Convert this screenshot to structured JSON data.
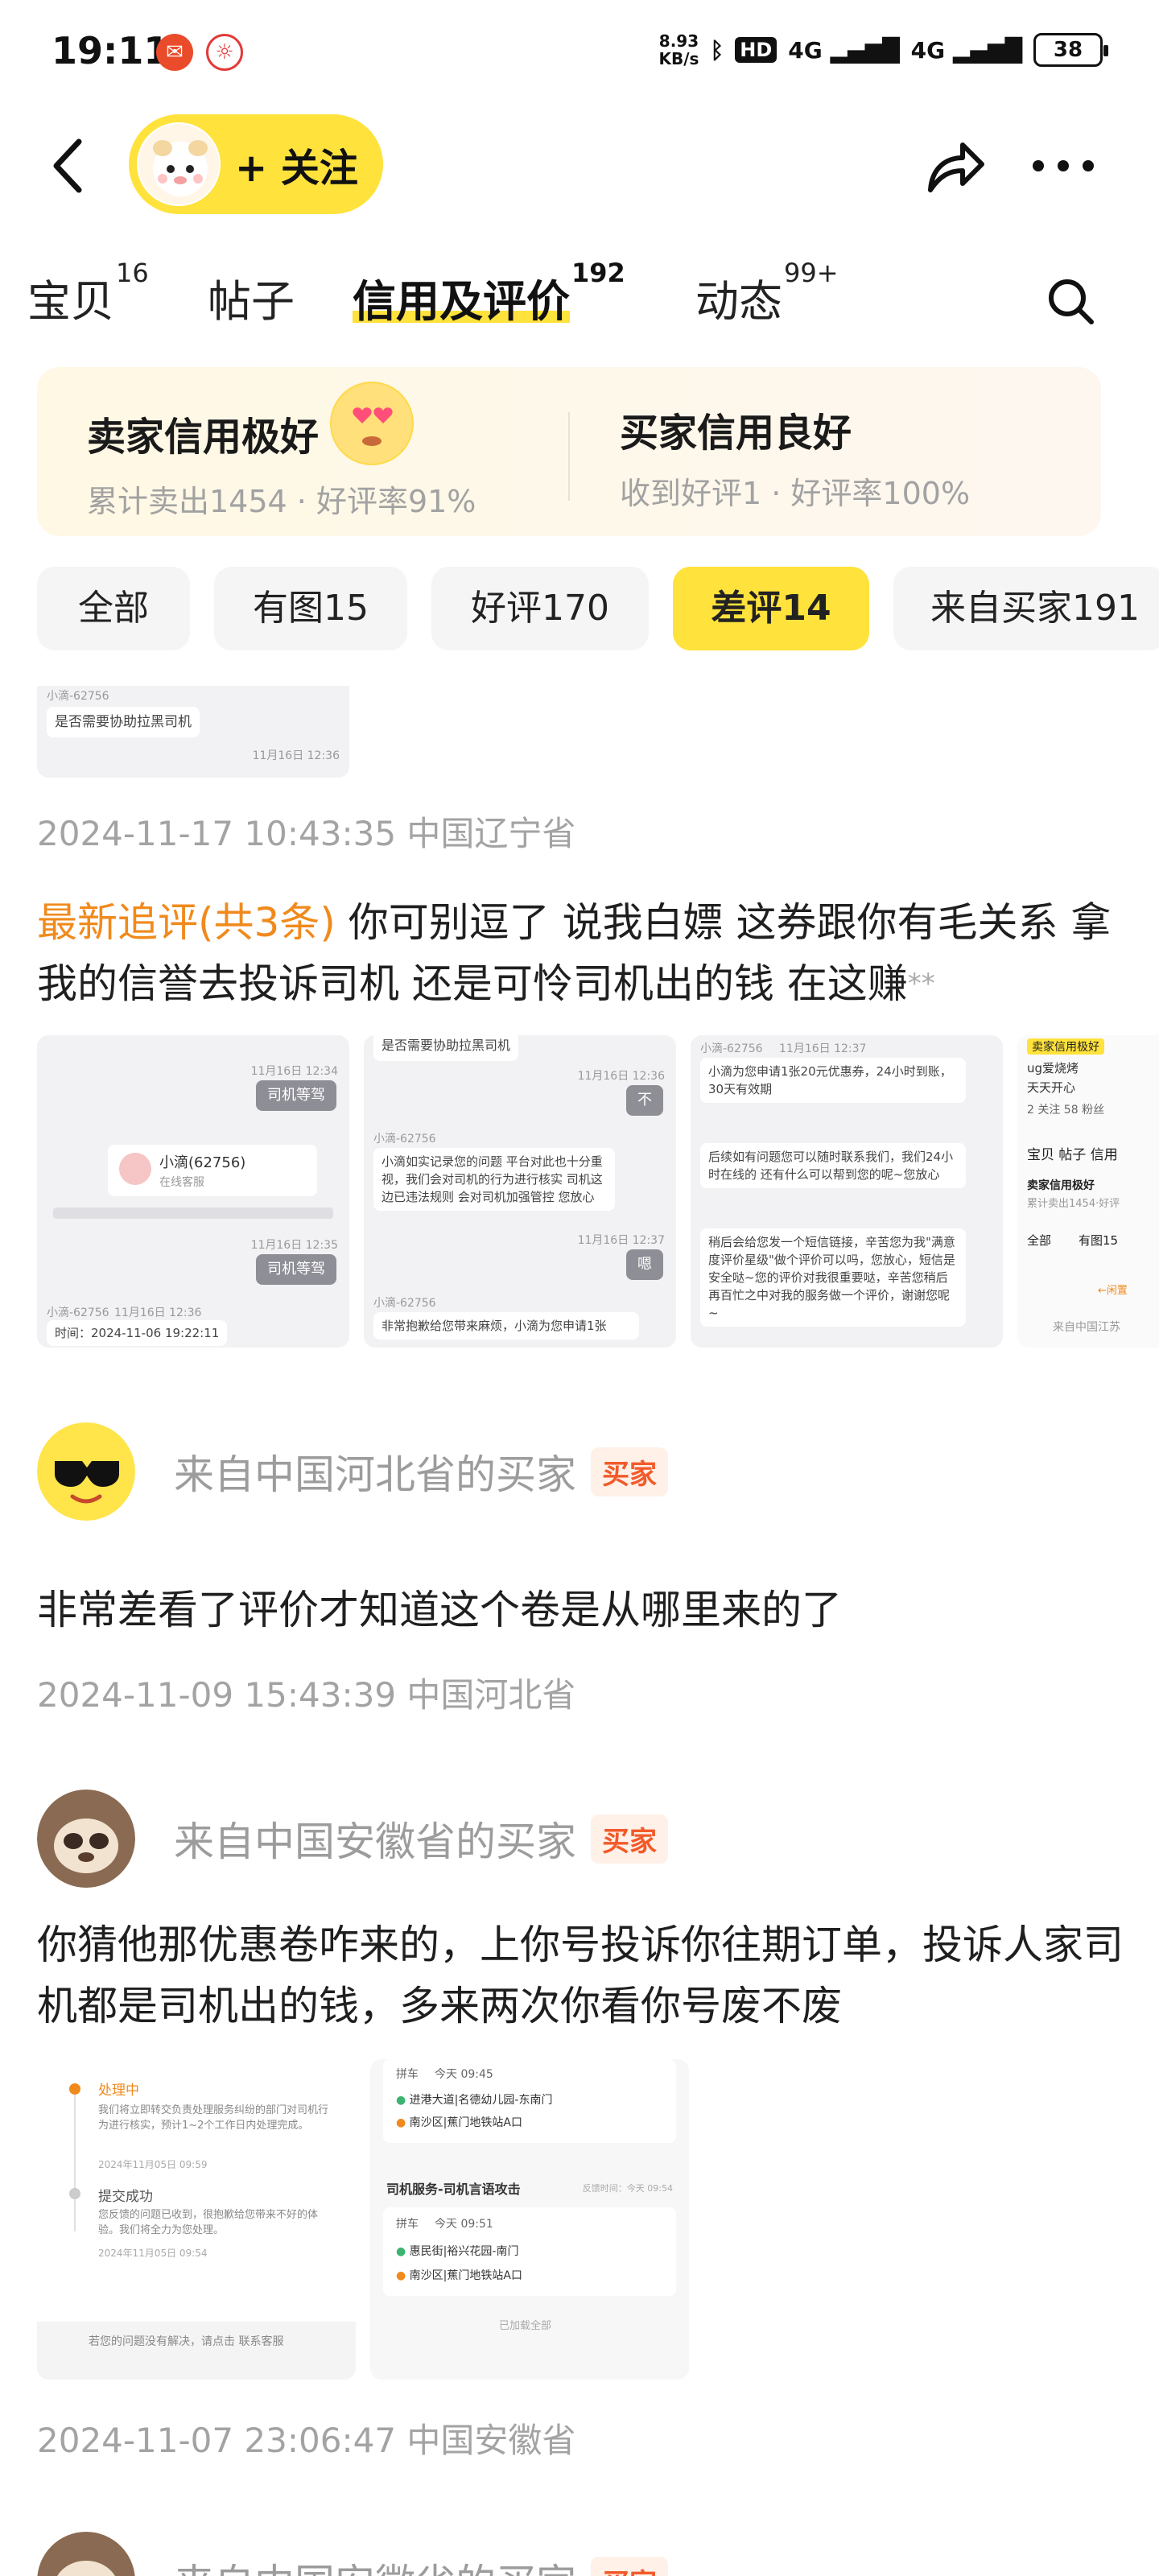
{
  "status_bar": {
    "time": "19:11",
    "speed": "8.93",
    "speed_unit": "KB/s",
    "hd_label": "HD",
    "net1": "4G",
    "net2": "4G",
    "battery": "38"
  },
  "header": {
    "follow_label": "+ 关注",
    "icons": [
      "back-icon",
      "share-icon",
      "more-icon"
    ]
  },
  "tabs": [
    {
      "label": "宝贝",
      "count": "16"
    },
    {
      "label": "帖子",
      "count": ""
    },
    {
      "label": "信用及评价",
      "count": "192"
    },
    {
      "label": "动态",
      "count": "99+"
    }
  ],
  "credit": {
    "seller_title": "卖家信用极好",
    "seller_sub": "累计卖出1454 · 好评率91%",
    "buyer_title": "买家信用良好",
    "buyer_sub": "收到好评1 · 好评率100%"
  },
  "filters": [
    "全部",
    "有图15",
    "好评170",
    "差评14",
    "来自买家191"
  ],
  "active_filter": "差评14",
  "review0": {
    "shot_meta": "小滴-62756",
    "shot_text": "是否需要协助拉黑司机",
    "shot_time": "11月16日 12:36",
    "timestamp": "2024-11-17 10:43:35 中国辽宁省",
    "followup_label": "最新追评(共3条)",
    "followup_text": " 你可别逗了 说我白嫖 这券跟你有毛关系 拿我的信誉去投诉司机 还是可怜司机出的钱 在这赚",
    "followup_tail": "**",
    "screens": {
      "s1": {
        "btn1": "司机等驾",
        "card_name": "小滴(62756)",
        "card_sub": "在线客服",
        "btn2": "司机等驾",
        "agent": "小滴-62756",
        "time_label": "时间：2024-11-06 19:22:11",
        "t1": "11月16日 12:34",
        "t2": "11月16日 12:35",
        "t3": "11月16日 12:36"
      },
      "s2": {
        "top": "是否需要协助拉黑司机",
        "agent": "小滴-62756",
        "msg": "小滴如实记录您的问题 平台对此也十分重视，我们会对司机的行为进行核实 司机这边已违法规则 会对司机加强管控 您放心",
        "b1": "不",
        "b2": "嗯",
        "agent2": "小滴-62756",
        "msg2": "非常抱歉给您带来麻烦，小滴为您申请1张",
        "t1": "11月16日 12:36",
        "t2": "11月16日 12:37"
      },
      "s3": {
        "agent": "小滴-62756",
        "msg1": "小滴为您申请1张20元优惠券，24小时到账，30天有效期",
        "msg2": "后续如有问题您可以随时联系我们，我们24小时在线的 还有什么可以帮到您的呢~您放心",
        "msg3": "稍后会给您发一个短信链接，辛苦您为我\"满意度评价星级\"做个评价可以吗，您放心，短信是安全哒~您的评价对我很重要哒，辛苦您稍后再百忙之中对我的服务做一个评价，谢谢您呢~",
        "t1": "11月16日 12:37"
      },
      "s4": {
        "badge": "卖家信用极好",
        "l1": "ug爱烧烤",
        "l2": "天天开心",
        "stats": "2 关注  58 粉丝",
        "tabs": "宝贝  帖子  信用",
        "c1": "卖家信用极好",
        "c2": "累计卖出1454·好评",
        "f1": "全部",
        "f2": "有图15",
        "more": "←闲置",
        "foot": "来自中国江苏"
      }
    }
  },
  "review1": {
    "name": "来自中国河北省的买家",
    "badge": "买家",
    "text": "非常差看了评价才知道这个卷是从哪里来的了",
    "timestamp": "2024-11-09 15:43:39 中国河北省"
  },
  "review2": {
    "name": "来自中国安徽省的买家",
    "badge": "买家",
    "text": "你猜他那优惠卷咋来的，上你号投诉你往期订单，投诉人家司机都是司机出的钱，多来两次你看你号废不废",
    "timestamp": "2024-11-07 23:06:47 中国安徽省",
    "screens": {
      "a": {
        "step1": "处理中",
        "step1_desc": "我们将立即转交负责处理服务纠纷的部门对司机行为进行核实，预计1~2个工作日内处理完成。",
        "step1_time": "2024年11月05日 09:59",
        "step2": "提交成功",
        "step2_desc": "您反馈的问题已收到，很抱歉给您带来不好的体验。我们将全力为您处理。",
        "step2_time": "2024年11月05日 09:54",
        "foot": "若您的问题没有解决，请点击 联系客服"
      },
      "b": {
        "tag1": "拼车",
        "time1": "今天 09:45",
        "from1": "进港大道|名德幼儿园-东南门",
        "to1": "南沙区|蕉门地铁站A口",
        "title": "司机服务-司机言语攻击",
        "title_time": "反馈时间：今天 09:54",
        "tag2": "拼车",
        "time2": "今天 09:51",
        "from2": "惠民街|裕兴花园-南门",
        "to2": "南沙区|蕉门地铁站A口",
        "foot": "已加载全部"
      }
    }
  },
  "review3": {
    "name": "来自中国安徽省的买家",
    "badge": "买家"
  }
}
